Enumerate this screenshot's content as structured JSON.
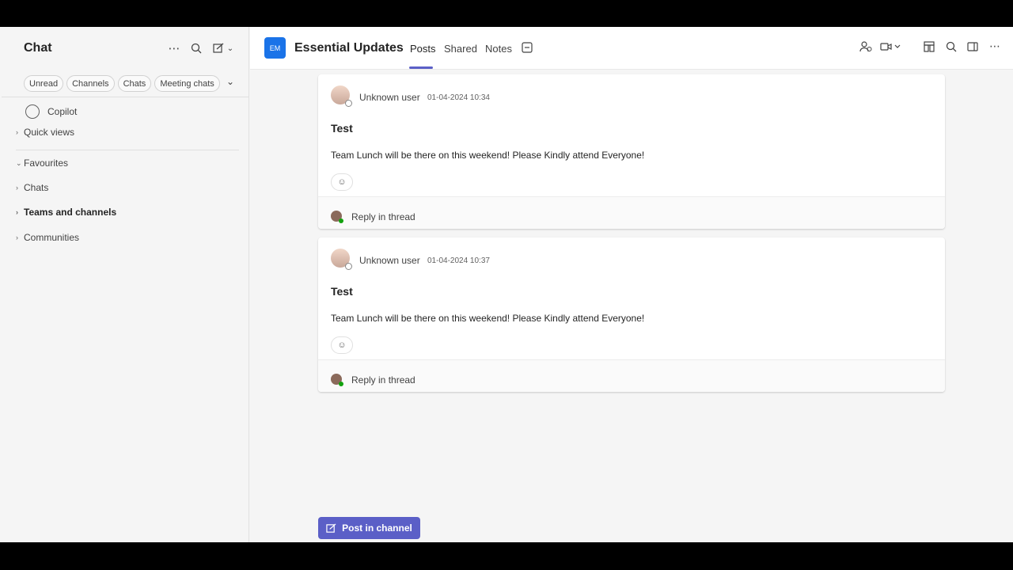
{
  "left_pane": {
    "title": "Chat",
    "filters": [
      "Unread",
      "Channels",
      "Chats",
      "Meeting chats"
    ],
    "copilot": "Copilot",
    "quick_views": "Quick views",
    "favourites": "Favourites",
    "chats": "Chats",
    "teams_and_channels": "Teams and channels",
    "communities": "Communities"
  },
  "header": {
    "team_initials": "EM",
    "team_name": "Essential Updates",
    "tabs": [
      "Posts",
      "Shared",
      "Notes"
    ],
    "active_tab": "Posts"
  },
  "posts": [
    {
      "author": "Unknown user",
      "timestamp": "01-04-2024 10:34",
      "subject": "Test",
      "body": "Team Lunch will be there on this weekend! Please Kindly attend Everyone!",
      "reply_label": "Reply in thread"
    },
    {
      "author": "Unknown user",
      "timestamp": "01-04-2024 10:37",
      "subject": "Test",
      "body": "Team Lunch will be there on this weekend! Please Kindly attend Everyone!",
      "reply_label": "Reply in thread"
    }
  ],
  "compose": {
    "post_label": "Post in channel"
  },
  "colors": {
    "accent": "#5b5fc7",
    "team_avatar": "#1a73e8"
  }
}
